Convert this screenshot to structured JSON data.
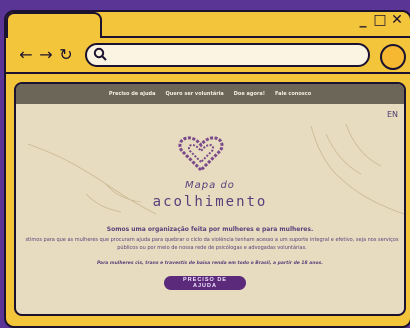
{
  "window": {
    "controls": [
      "_",
      "□",
      "✕"
    ]
  },
  "browser": {
    "nav": [
      "←",
      "→",
      "↻"
    ],
    "url_placeholder": ""
  },
  "site": {
    "menu": [
      "Preciso de ajuda",
      "Quero ser voluntária",
      "Doe agora!",
      "Fale conosco"
    ],
    "language": "EN",
    "brand_line1": "Mapa do",
    "brand_line2": "acolhimento",
    "tagline": "Somos uma organização feita por mulheres e para mulheres.",
    "description_line1": "stimos para que as mulheres que procuram ajuda para quebrar o ciclo da violência tenham acesso a um suporte integral e efetivo, seja nos serviços",
    "description_line2": "públicos ou por meio de nossa rede de psicólogas e advogadas voluntárias.",
    "note": "Para mulheres cis, trans e travestis de baixa renda em todo o Brasil, a partir de 18 anos.",
    "cta": "PRECISO DE AJUDA"
  },
  "colors": {
    "background": "#5a3596",
    "window": "#f3c53a",
    "page": "#e7dcc0",
    "accent": "#5b2a7a",
    "heart": "#7a4a8a"
  }
}
